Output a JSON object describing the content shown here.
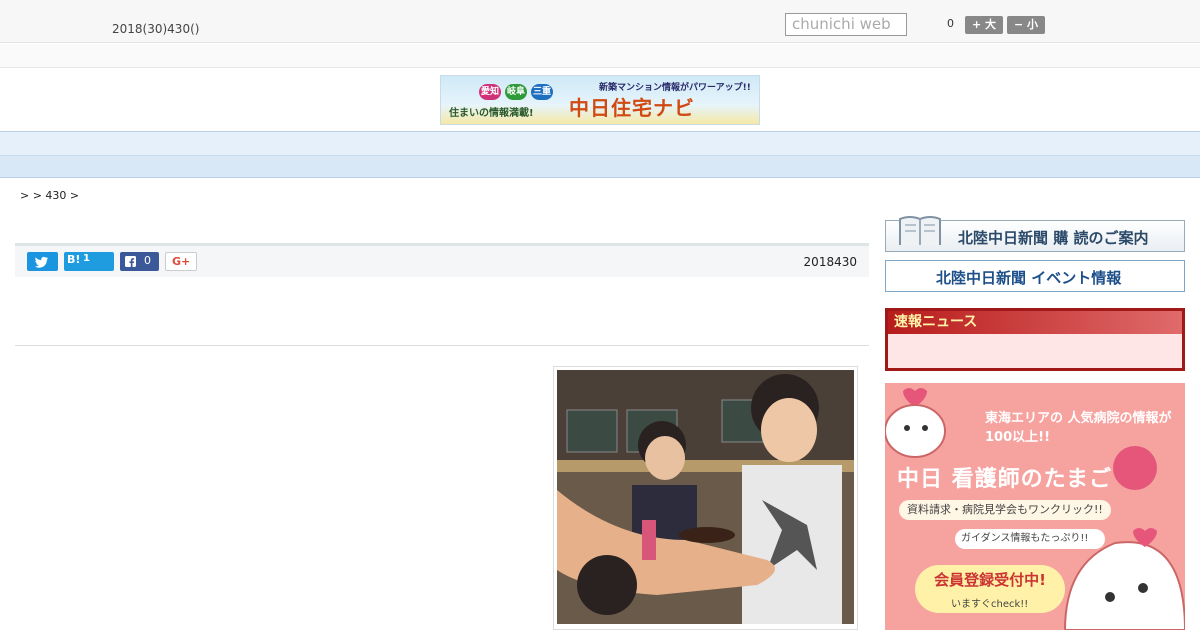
{
  "header": {
    "date": "2018(30)430()",
    "search_placeholder": "chunichi web",
    "font_size_value": "0",
    "font_bigger_label": "+ 大",
    "font_smaller_label": "− 小"
  },
  "banner": {
    "tags": [
      "愛知",
      "岐阜",
      "三重"
    ],
    "left_text": "住まいの情報満載!",
    "top_text": "新築マンション情報がパワーアップ!!",
    "main_text": "中日住宅ナビ"
  },
  "nav": {
    "items": [
      "　　",
      "　　",
      "　　",
      "　　",
      "　　",
      "　　",
      "　　",
      "　　",
      "　　"
    ]
  },
  "breadcrumb": ">  > 430 >",
  "share": {
    "hatebu_count": "1",
    "facebook_count": "0",
    "gplus_label": "G+",
    "hatebu_label": "B!"
  },
  "article": {
    "date": "2018430"
  },
  "sidebar": {
    "subscribe": "北陸中日新聞 購 読のご案内",
    "event": "北陸中日新聞 イベント情報",
    "news_title": "速報ニュース",
    "ad": {
      "line1": "東海エリアの 人気病院の情報が100以上!!",
      "line2": "中日 看護師のたまご",
      "line3": "資料請求・病院見学会もワンクリック!!",
      "line4": "ガイダンス情報もたっぷり!!",
      "line5": "会員登録受付中!",
      "line6": "いますぐcheck!!"
    }
  },
  "colors": {
    "nav_bg": "#e6f0fa",
    "news_border": "#a01818",
    "twitter": "#1b95e0",
    "facebook": "#3b5998"
  }
}
